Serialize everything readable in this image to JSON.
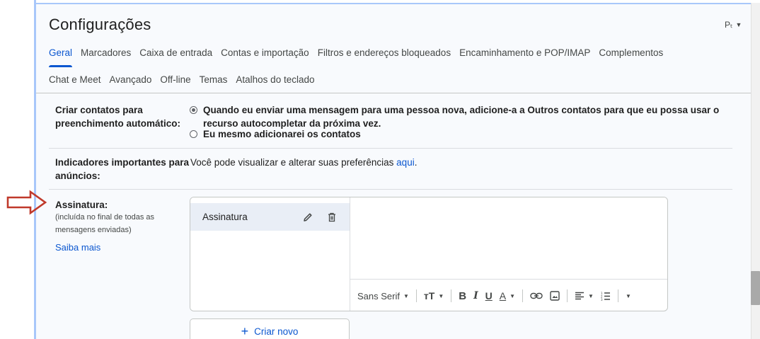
{
  "header": {
    "title": "Configurações",
    "input_tools": "Pₜ"
  },
  "tabs_row1": [
    "Geral",
    "Marcadores",
    "Caixa de entrada",
    "Contas e importação",
    "Filtros e endereços bloqueados",
    "Encaminhamento e POP/IMAP",
    "Complementos"
  ],
  "tabs_row2": [
    "Chat e Meet",
    "Avançado",
    "Off-line",
    "Temas",
    "Atalhos do teclado"
  ],
  "active_tab": "Geral",
  "auto_contacts": {
    "label_line1": "Criar contatos para",
    "label_line2": "preenchimento automático:",
    "option1_line1": "Quando eu enviar uma mensagem para uma pessoa nova, adicione-a a Outros contatos para que eu possa usar o",
    "option1_line2": "recurso autocompletar da próxima vez.",
    "option2": "Eu mesmo adicionarei os contatos"
  },
  "ad_indicators": {
    "label_line1": "Indicadores importantes para",
    "label_line2": "anúncios:",
    "text": "Você pode visualizar e alterar suas preferências ",
    "link": "aqui",
    "suffix": "."
  },
  "signature": {
    "label": "Assinatura:",
    "note_line1": "(incluída no final de todas as",
    "note_line2": "mensagens enviadas)",
    "learn_more": "Saiba mais",
    "items": [
      {
        "name": "Assinatura"
      }
    ],
    "toolbar": {
      "font": "Sans Serif",
      "bold": "B",
      "italic": "I",
      "underline": "U",
      "text_color": "A"
    },
    "create_new": "Criar novo"
  },
  "colors": {
    "accent": "#0b57d0",
    "arrow": "#c0392b"
  }
}
